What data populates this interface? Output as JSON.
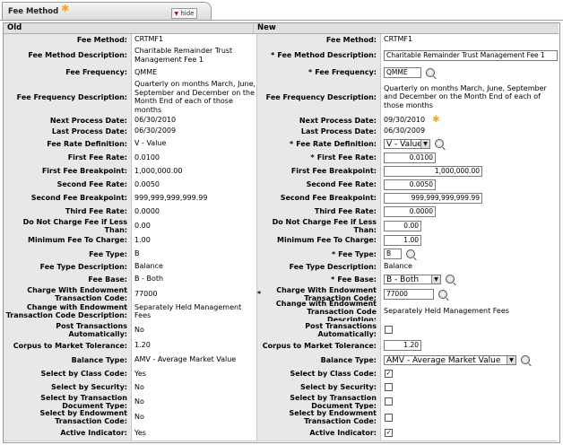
{
  "tab": {
    "title": "Fee Method",
    "hide_label": "hide"
  },
  "headers": {
    "old": "Old",
    "new": "New"
  },
  "rows": [
    {
      "label": "Fee Method:",
      "old": "CRTMF1",
      "new": "CRTMF1",
      "req": false,
      "new_type": "text"
    },
    {
      "label": "Fee Method Description:",
      "old": "Charitable Remainder Trust Management Fee 1",
      "new": "Charitable Remainder Trust Management Fee 1",
      "req": true,
      "new_type": "input"
    },
    {
      "label": "Fee Frequency:",
      "old": "QMME",
      "new": "QMME",
      "req": true,
      "new_type": "input-lookup"
    },
    {
      "label": "Fee Frequency Description:",
      "old": "Quarterly on months March, June, September and December on the Month End of each of those months",
      "new": "Quarterly on months March, June, September and December on the Month End of each of those months",
      "req": false,
      "new_type": "text"
    },
    {
      "label": "Next Process Date:",
      "old": "06/30/2010",
      "new": "09/30/2010",
      "req": false,
      "new_type": "text-star"
    },
    {
      "label": "Last Process Date:",
      "old": "06/30/2009",
      "new": "06/30/2009",
      "req": false,
      "new_type": "text"
    },
    {
      "label": "Fee Rate Definition:",
      "old": "V - Value",
      "new": "V - Value",
      "req": true,
      "new_type": "select"
    },
    {
      "label": "First Fee Rate:",
      "old": "0.0100",
      "new": "0.0100",
      "req": true,
      "new_type": "input"
    },
    {
      "label": "First Fee Breakpoint:",
      "old": "1,000,000.00",
      "new": "1,000,000.00",
      "req": false,
      "new_type": "input"
    },
    {
      "label": "Second Fee Rate:",
      "old": "0.0050",
      "new": "0.0050",
      "req": false,
      "new_type": "input"
    },
    {
      "label": "Second Fee Breakpoint:",
      "old": "999,999,999,999.99",
      "new": "999,999,999,999.99",
      "req": false,
      "new_type": "input"
    },
    {
      "label": "Third Fee Rate:",
      "old": "0.0000",
      "new": "0.0000",
      "req": false,
      "new_type": "input"
    },
    {
      "label": "Do Not Charge Fee if Less Than:",
      "old": "0.00",
      "new": "0.00",
      "req": false,
      "new_type": "input"
    },
    {
      "label": "Minimum Fee To Charge:",
      "old": "1.00",
      "new": "1.00",
      "req": false,
      "new_type": "input"
    },
    {
      "label": "Fee Type:",
      "old": "B",
      "new": "B",
      "req": true,
      "new_type": "input-lookup"
    },
    {
      "label": "Fee Type Description:",
      "old": "Balance",
      "new": "Balance",
      "req": false,
      "new_type": "text"
    },
    {
      "label": "Fee Base:",
      "old": "B - Both",
      "new": "B - Both",
      "req": true,
      "new_type": "select"
    },
    {
      "label": "Charge With Endowment Transaction Code:",
      "old": "77000",
      "new": "77000",
      "req": true,
      "new_type": "input-lookup"
    },
    {
      "label": "Change with Endowment Transaction Code Description:",
      "old": "Separately Held Management Fees",
      "new": "Separately Held Management Fees",
      "req": false,
      "new_type": "text"
    },
    {
      "label": "Post Transactions Automatically:",
      "old": "No",
      "new": "",
      "req": false,
      "new_type": "checkbox",
      "checked": false
    },
    {
      "label": "Corpus to Market Tolerance:",
      "old": "1.20",
      "new": "1.20",
      "req": false,
      "new_type": "input"
    },
    {
      "label": "Balance Type:",
      "old": "AMV - Average Market Value",
      "new": "AMV - Average Market Value",
      "req": false,
      "new_type": "select"
    },
    {
      "label": "Select by Class Code:",
      "old": "Yes",
      "new": "",
      "req": false,
      "new_type": "checkbox",
      "checked": true
    },
    {
      "label": "Select by Security:",
      "old": "No",
      "new": "",
      "req": false,
      "new_type": "checkbox",
      "checked": false
    },
    {
      "label": "Select by Transaction Document Type:",
      "old": "No",
      "new": "",
      "req": false,
      "new_type": "checkbox",
      "checked": false
    },
    {
      "label": "Select by Endowment Transaction Code:",
      "old": "No",
      "new": "",
      "req": false,
      "new_type": "checkbox",
      "checked": false
    },
    {
      "label": "Active Indicator:",
      "old": "Yes",
      "new": "",
      "req": false,
      "new_type": "checkbox",
      "checked": true
    }
  ],
  "icons": {
    "required": "asterisk",
    "lookup": "magnifier-icon",
    "changed": "star-icon"
  },
  "colors": {
    "star": "#f5a623",
    "label_bg": "#e8e8e8",
    "header_bg": "#e0e0e0"
  }
}
